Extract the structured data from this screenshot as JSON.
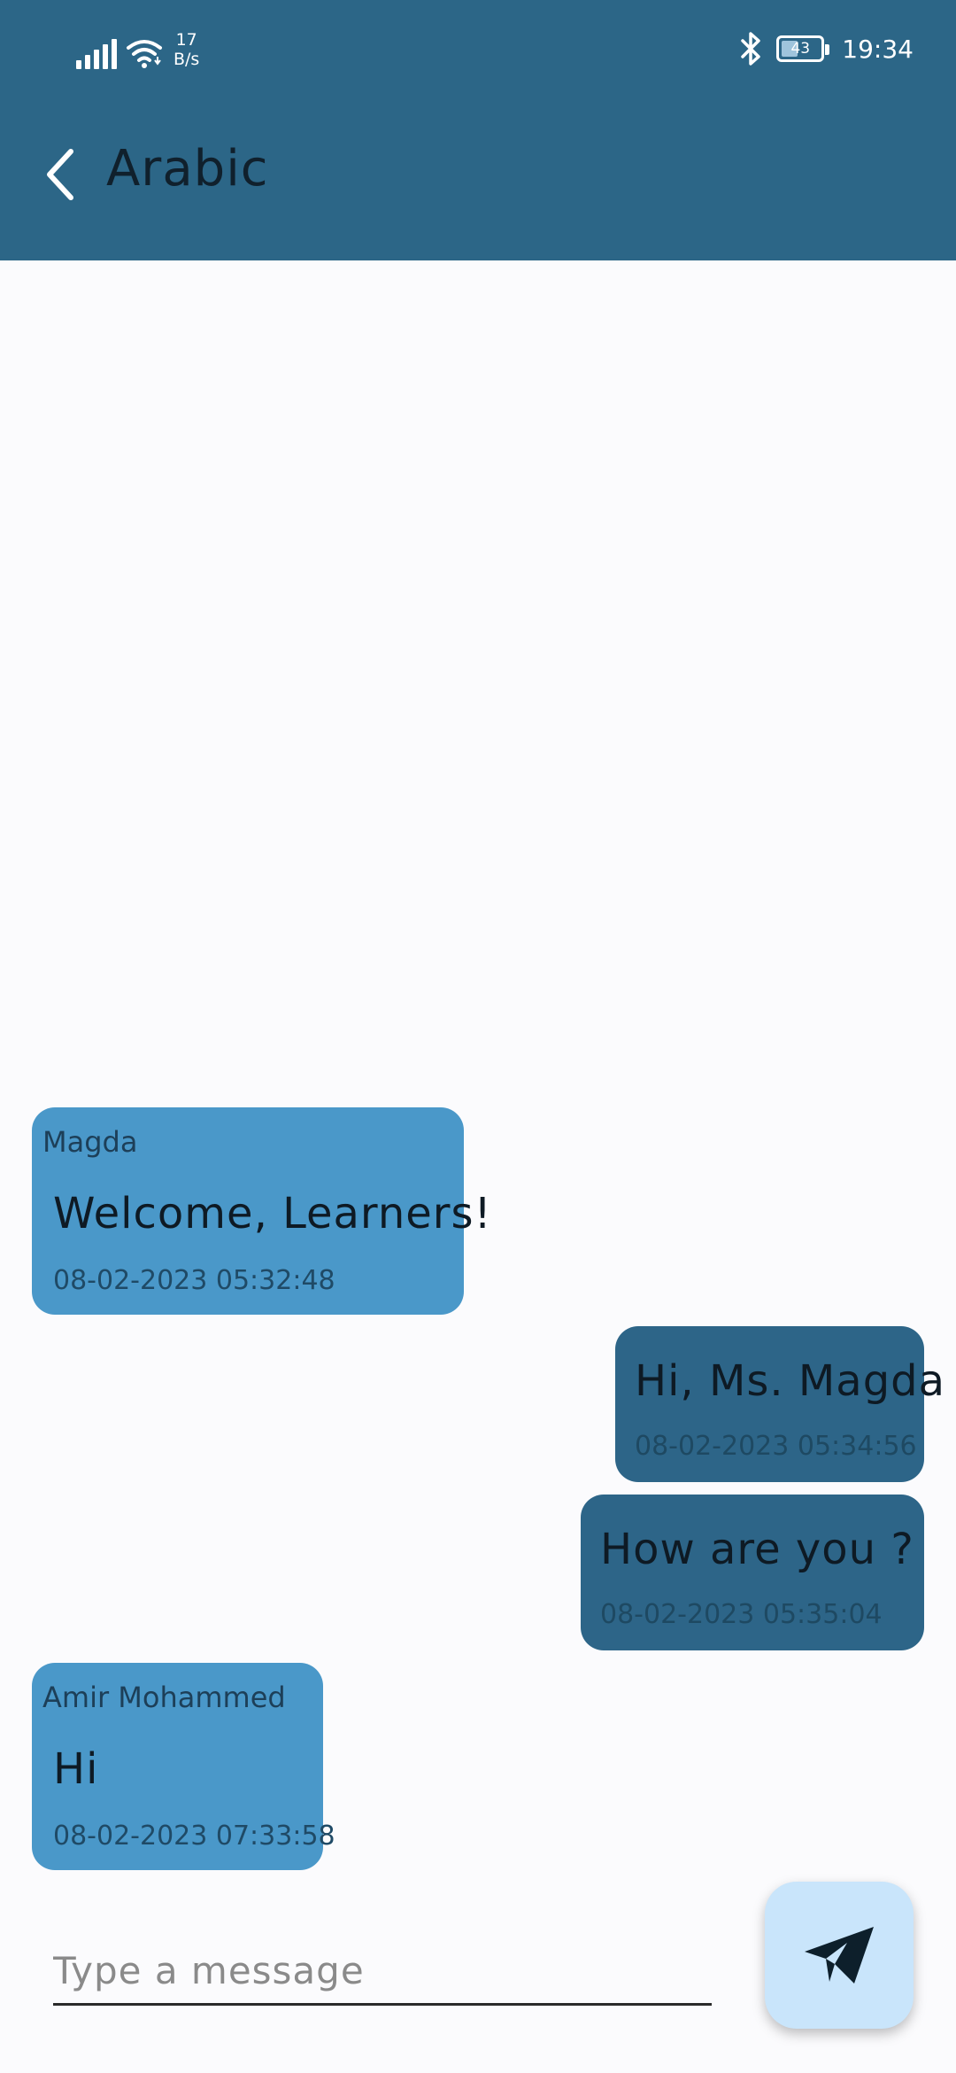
{
  "status_bar": {
    "net_speed_value": "17",
    "net_speed_unit": "B/s",
    "battery_level": "43",
    "battery_fraction": 0.43,
    "time": "19:34",
    "icons": [
      "signal-icon",
      "wifi-icon",
      "bluetooth-icon",
      "battery-icon"
    ]
  },
  "app_bar": {
    "title": "Arabic",
    "back_icon": "chevron-left-icon",
    "color": "#2c6687"
  },
  "messages": [
    {
      "direction": "incoming",
      "sender": "Magda",
      "text": "Welcome, Learners!",
      "time": "08-02-2023 05:32:48"
    },
    {
      "direction": "outgoing",
      "sender": "",
      "text": "Hi, Ms. Magda",
      "time": "08-02-2023 05:34:56"
    },
    {
      "direction": "outgoing",
      "sender": "",
      "text": "How are you ?",
      "time": "08-02-2023 05:35:04"
    },
    {
      "direction": "incoming",
      "sender": "Amir Mohammed",
      "text": "Hi",
      "time": "08-02-2023 07:33:58"
    }
  ],
  "composer": {
    "placeholder": "Type a message",
    "value": "",
    "send_icon": "send-icon"
  },
  "colors": {
    "incoming_bubble": "#4a98c9",
    "outgoing_bubble": "#2d6588",
    "send_button_bg": "#c9e5fb",
    "page_bg": "#fbfbfd"
  }
}
